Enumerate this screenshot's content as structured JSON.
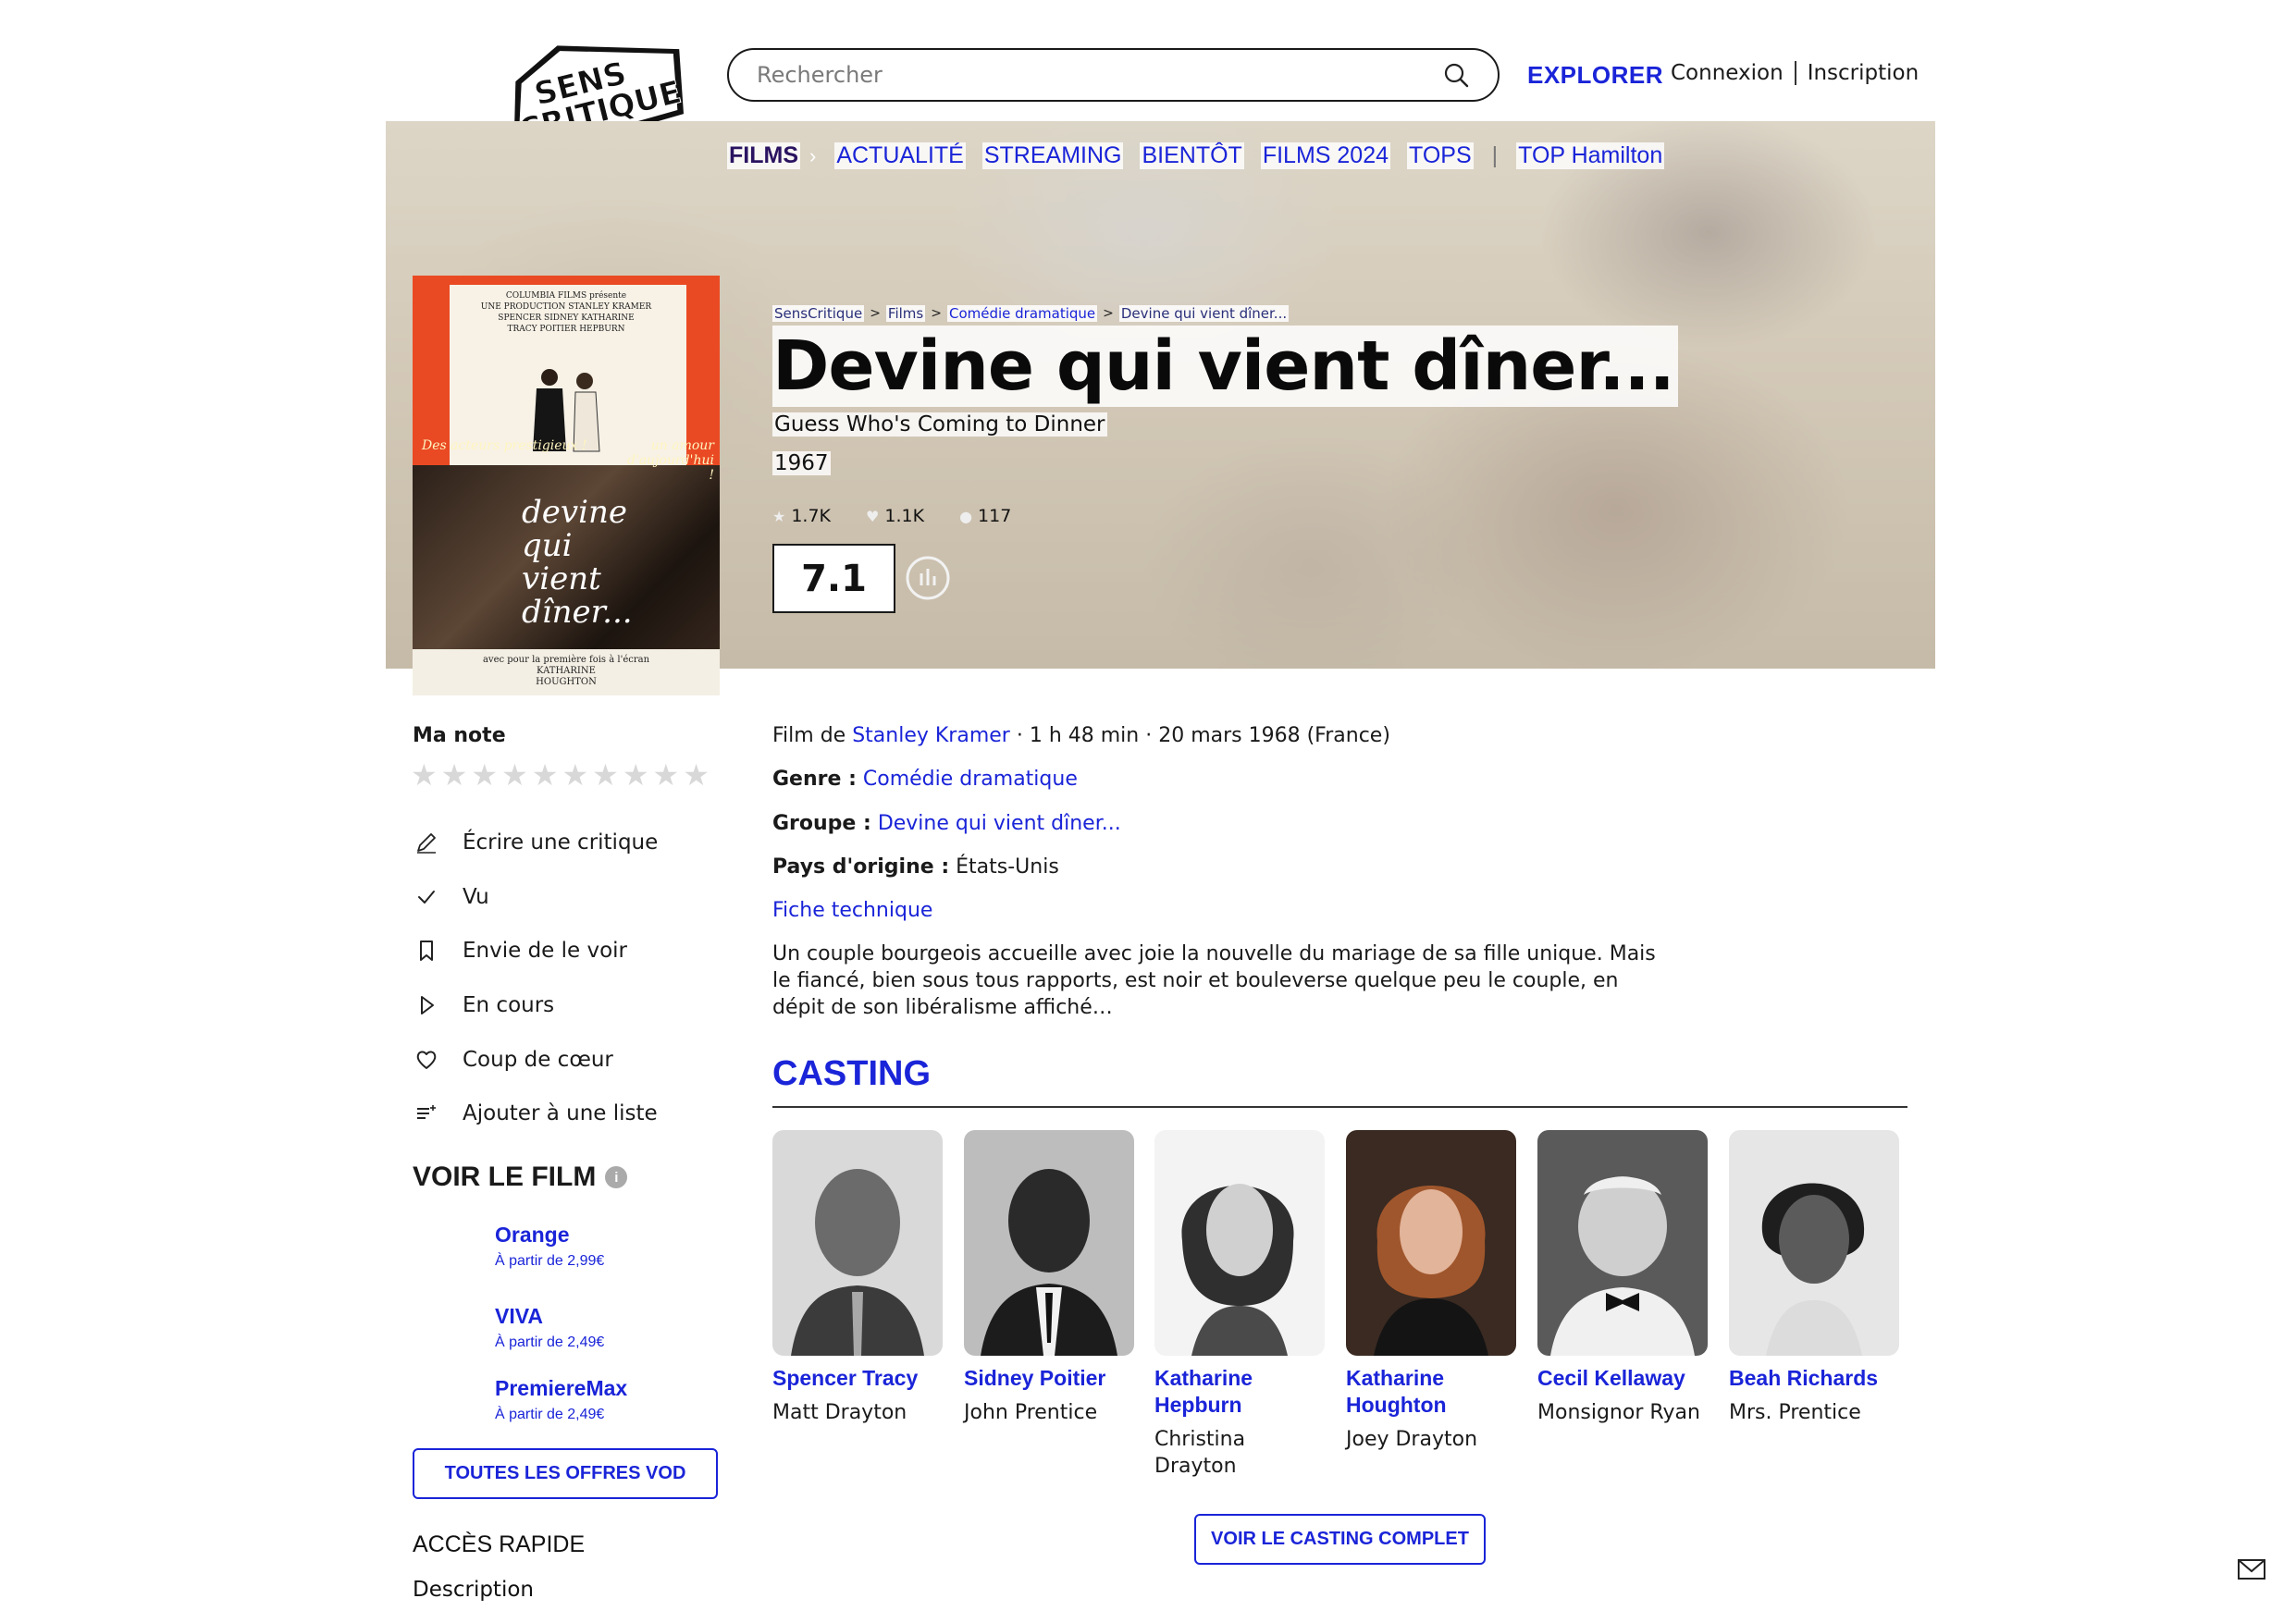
{
  "header": {
    "logo_text": [
      "SENS",
      "CRITIQUE"
    ],
    "search_placeholder": "Rechercher",
    "explorer": "EXPLORER",
    "login": "Connexion",
    "signup": "Inscription"
  },
  "nav": {
    "items": [
      "FILMS",
      "ACTUALITÉ",
      "STREAMING",
      "BIENTÔT",
      "FILMS 2024",
      "TOPS",
      "TOP Hamilton"
    ],
    "active": "FILMS"
  },
  "poster": {
    "credits_line1": "COLUMBIA FILMS présente",
    "credits_line2": "UNE PRODUCTION STANLEY KRAMER",
    "credits_line3": "SPENCER   SIDNEY   KATHARINE",
    "credits_line4": "TRACY  POITIER  HEPBURN",
    "left_tagline": "Des acteurs prestigieux !",
    "right_tagline": "un amour d'aujourd'hui !",
    "title": "devine qui vient dîner...",
    "bottom_line1": "avec pour la première fois à l'écran",
    "bottom_line2": "KATHARINE",
    "bottom_line3": "HOUGHTON"
  },
  "breadcrumb": [
    "SensCritique",
    "Films",
    "Comédie dramatique",
    "Devine qui vient dîner..."
  ],
  "film": {
    "title": "Devine qui vient dîner...",
    "original_title": "Guess Who's Coming to Dinner",
    "year": "1967",
    "stats": [
      "1.7K",
      "1.1K",
      "117"
    ],
    "score": "7.1",
    "director_prefix": "Film de",
    "director": "Stanley Kramer",
    "meta": "· 1 h 48 min · 20 mars 1968 (France)",
    "genre_label": "Genre :",
    "genre": "Comédie dramatique",
    "group_label": "Groupe :",
    "group": "Devine qui vient dîner...",
    "country_label": "Pays d'origine :",
    "country": "États-Unis",
    "tech_sheet": "Fiche technique",
    "synopsis": "Un couple bourgeois accueille avec joie la nouvelle du mariage de sa fille unique. Mais le fiancé, bien sous tous rapports, est noir et bouleverse quelque peu le couple, en dépit de son libéralisme affiché…"
  },
  "sidebar": {
    "my_rating": "Ma note",
    "actions": [
      {
        "label": "Écrire une critique",
        "icon": "pencil-icon"
      },
      {
        "label": "Vu",
        "icon": "check-icon"
      },
      {
        "label": "Envie de le voir",
        "icon": "bookmark-icon"
      },
      {
        "label": "En cours",
        "icon": "play-icon"
      },
      {
        "label": "Coup de cœur",
        "icon": "heart-icon"
      },
      {
        "label": "Ajouter à une liste",
        "icon": "list-add-icon"
      }
    ],
    "watch_title": "VOIR LE FILM",
    "vod": [
      {
        "name": "Orange",
        "price": "À partir de 2,99€"
      },
      {
        "name": "VIVA",
        "price": "À partir de 2,49€"
      },
      {
        "name": "PremiereMax",
        "price": "À partir de 2,49€"
      }
    ],
    "vod_button": "TOUTES LES OFFRES VOD",
    "quick_access": "ACCÈS RAPIDE",
    "description": "Description"
  },
  "casting": {
    "title": "CASTING",
    "cast": [
      {
        "name": "Spencer Tracy",
        "role": "Matt Drayton"
      },
      {
        "name": "Sidney Poitier",
        "role": "John Prentice"
      },
      {
        "name": "Katharine Hepburn",
        "role": "Christina Drayton"
      },
      {
        "name": "Katharine Houghton",
        "role": "Joey Drayton"
      },
      {
        "name": "Cecil Kellaway",
        "role": "Monsignor Ryan"
      },
      {
        "name": "Beah Richards",
        "role": "Mrs. Prentice"
      }
    ],
    "button": "VOIR LE CASTING COMPLET"
  },
  "colors": {
    "accent": "#1a24d8",
    "poster_red": "#ea4a23",
    "nav_active": "#2a1360"
  }
}
